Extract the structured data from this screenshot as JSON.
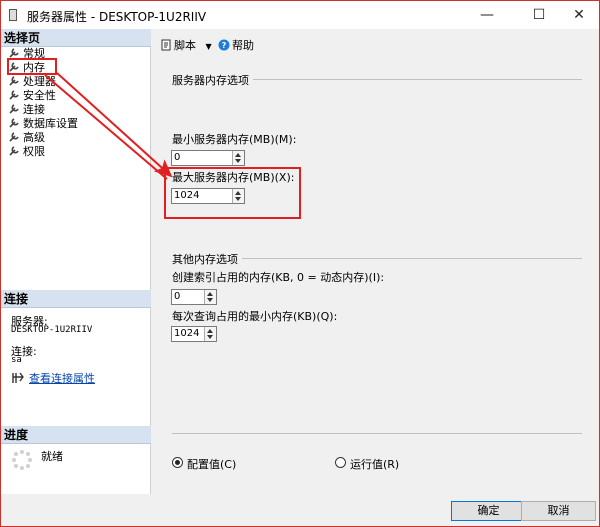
{
  "window": {
    "title": "服务器属性 - DESKTOP-1U2RIIV",
    "minimize_glyph": "—",
    "maximize_glyph": "☐",
    "close_glyph": "✕"
  },
  "left": {
    "select_page_header": "选择页",
    "pages": [
      "常规",
      "内存",
      "处理器",
      "安全性",
      "连接",
      "数据库设置",
      "高级",
      "权限"
    ],
    "connection_header": "连接",
    "server_label": "服务器:",
    "server_value": "DESKTOP-1U2RIIV",
    "connection_label": "连接:",
    "connection_value": "sa",
    "view_connection_link": "查看连接属性",
    "progress_header": "进度",
    "progress_status": "就绪"
  },
  "toolbar": {
    "script_label": "脚本",
    "help_label": "帮助"
  },
  "memory": {
    "server_memory_group": "服务器内存选项",
    "min_label": "最小服务器内存(MB)(M):",
    "min_value": "0",
    "max_label": "最大服务器内存(MB)(X):",
    "max_value": "1024",
    "other_group": "其他内存选项",
    "index_label": "创建索引占用的内存(KB, 0 = 动态内存)(I):",
    "index_value": "0",
    "query_label": "每次查询占用的最小内存(KB)(Q):",
    "query_value": "1024",
    "configured_label": "配置值(C)",
    "running_label": "运行值(R)"
  },
  "buttons": {
    "ok": "确定",
    "cancel": "取消"
  },
  "colors": {
    "annotation": "#e02020",
    "section_header": "#d7e2f0",
    "link": "#0645ad"
  }
}
